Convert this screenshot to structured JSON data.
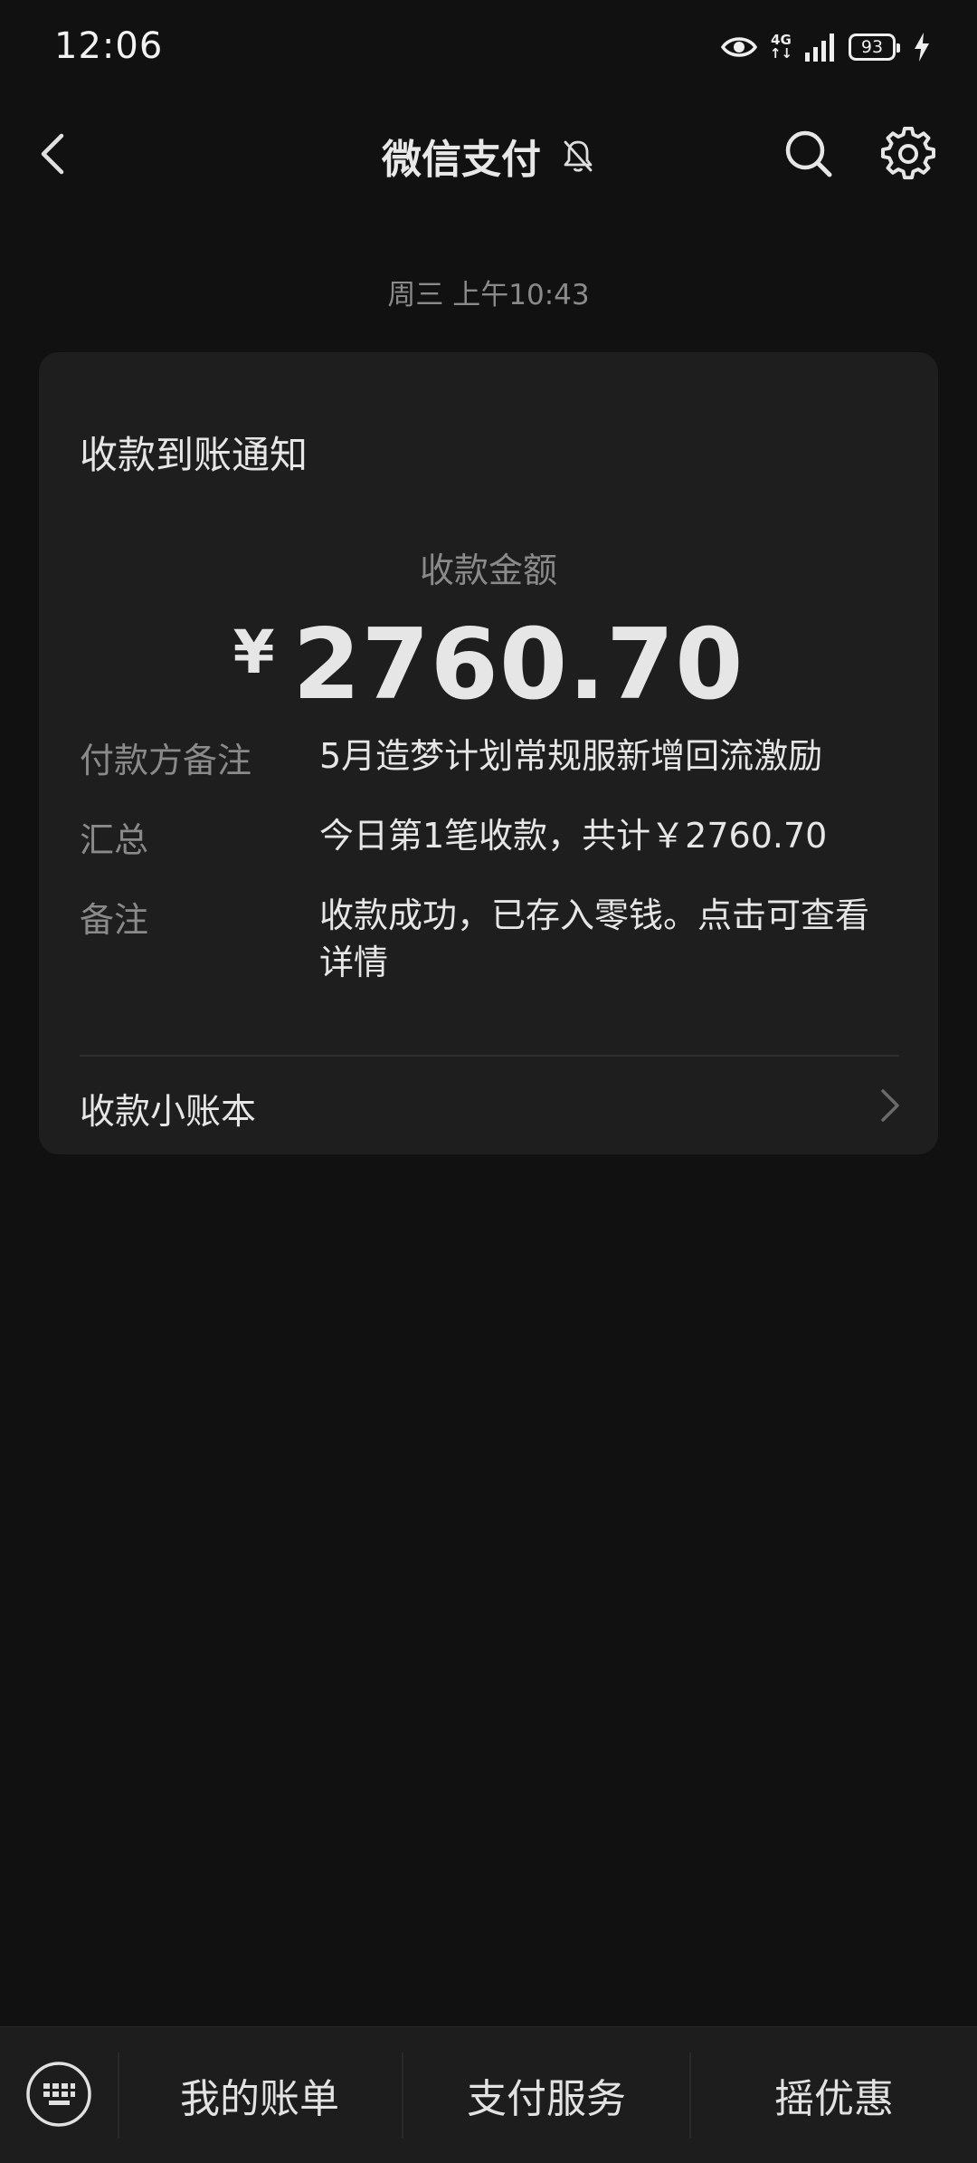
{
  "status_bar": {
    "time": "12:06",
    "network_top": "4G",
    "network_bottom": "↑↓",
    "battery": "93"
  },
  "header": {
    "title": "微信支付",
    "icons": [
      "back-arrow-icon",
      "mute-bell-icon",
      "search-icon",
      "gear-icon"
    ]
  },
  "timestamp": "周三 上午10:43",
  "card": {
    "title": "收款到账通知",
    "amount_label": "收款金额",
    "currency": "¥",
    "amount": "2760.70",
    "rows": [
      {
        "key": "付款方备注",
        "value": "5月造梦计划常规服新增回流激励"
      },
      {
        "key": "汇总",
        "value": "今日第1笔收款，共计￥2760.70"
      },
      {
        "key": "备注",
        "value": "收款成功，已存入零钱。点击可查看详情"
      }
    ],
    "ledger_label": "收款小账本"
  },
  "bottom_bar": {
    "items": [
      "我的账单",
      "支付服务",
      "摇优惠"
    ]
  },
  "colors": {
    "background": "#111111",
    "card": "#1e1e1e",
    "text_primary": "#e6e6e6",
    "text_secondary": "#8a8a8a"
  }
}
